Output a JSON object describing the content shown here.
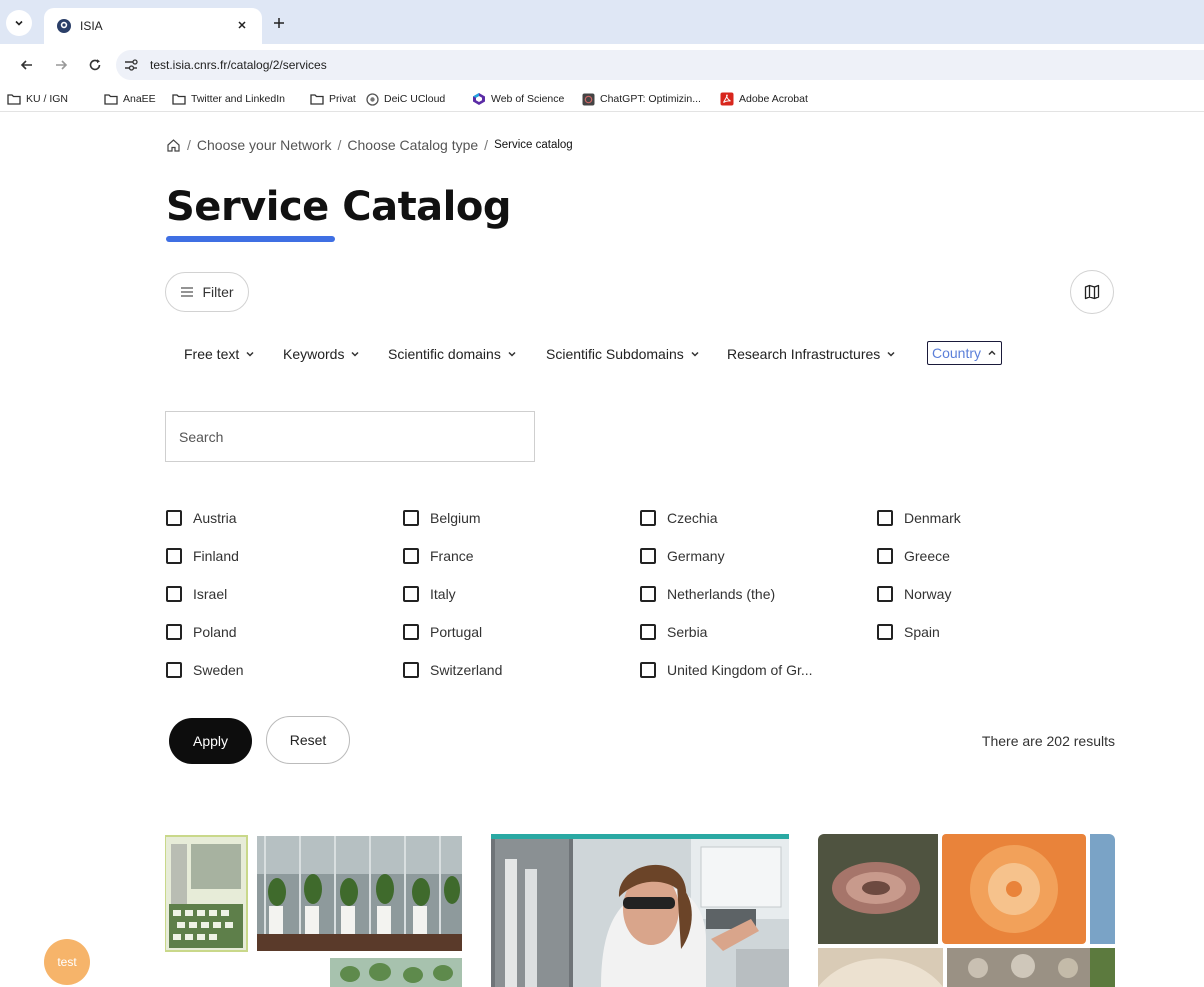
{
  "browser": {
    "tab_title": "ISIA",
    "url": "test.isia.cnrs.fr/catalog/2/services",
    "bookmarks": [
      {
        "label": "KU / IGN",
        "icon": "folder-icon"
      },
      {
        "label": "AnaEE",
        "icon": "folder-icon"
      },
      {
        "label": "Twitter and LinkedIn",
        "icon": "folder-icon"
      },
      {
        "label": "Privat",
        "icon": "folder-icon"
      },
      {
        "label": "DeiC UCloud",
        "icon": "ucloud-icon"
      },
      {
        "label": "Web of Science",
        "icon": "clarivate-icon"
      },
      {
        "label": "ChatGPT: Optimizin...",
        "icon": "chatgpt-icon"
      },
      {
        "label": "Adobe Acrobat",
        "icon": "acrobat-icon"
      }
    ]
  },
  "breadcrumb": {
    "items": [
      "Choose your Network",
      "Choose Catalog type"
    ],
    "current": "Service catalog",
    "separator": "/"
  },
  "page": {
    "title": "Service Catalog",
    "accent_color": "#3f6fe3"
  },
  "toolbar": {
    "filter_label": "Filter"
  },
  "filters": [
    {
      "label": "Free text",
      "state": "collapsed"
    },
    {
      "label": "Keywords",
      "state": "collapsed"
    },
    {
      "label": "Scientific domains",
      "state": "collapsed"
    },
    {
      "label": "Scientific Subdomains",
      "state": "collapsed"
    },
    {
      "label": "Research Infrastructures",
      "state": "collapsed"
    },
    {
      "label": "Country",
      "state": "expanded"
    }
  ],
  "search": {
    "placeholder": "Search",
    "value": ""
  },
  "countries": [
    "Austria",
    "Belgium",
    "Czechia",
    "Denmark",
    "Finland",
    "France",
    "Germany",
    "Greece",
    "Israel",
    "Italy",
    "Netherlands (the)",
    "Norway",
    "Poland",
    "Portugal",
    "Serbia",
    "Spain",
    "Sweden",
    "Switzerland",
    "United Kingdom of Gr..."
  ],
  "actions": {
    "apply_label": "Apply",
    "reset_label": "Reset"
  },
  "results_text": "There are 202 results",
  "user_badge": "test"
}
